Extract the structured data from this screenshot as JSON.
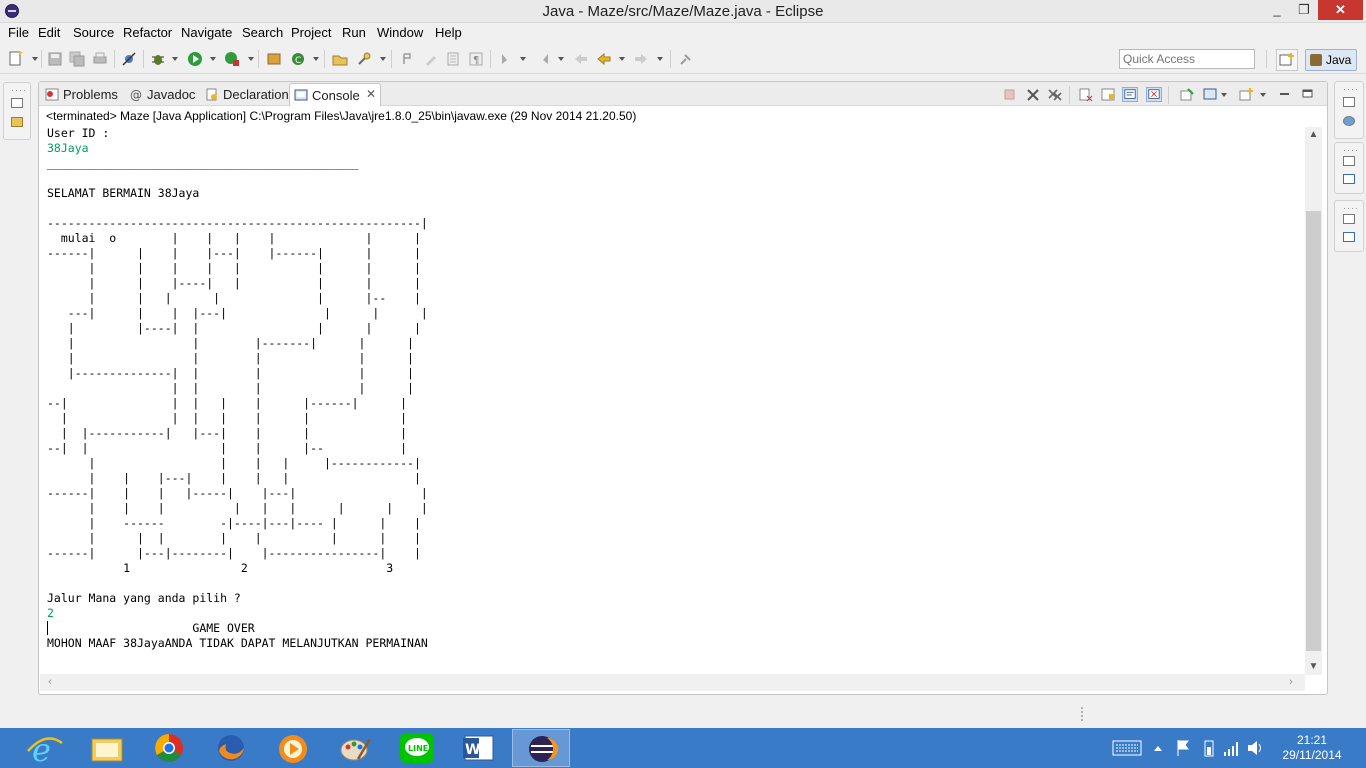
{
  "window": {
    "title": "Java - Maze/src/Maze/Maze.java - Eclipse",
    "min": "_",
    "max": "❐",
    "close": "✕"
  },
  "menu": {
    "items": [
      "File",
      "Edit",
      "Source",
      "Refactor",
      "Navigate",
      "Search",
      "Project",
      "Run",
      "Window",
      "Help"
    ]
  },
  "toolbar": {
    "quick_access_placeholder": "Quick Access",
    "perspective_label": "Java"
  },
  "tabs": [
    {
      "label": "Problems",
      "icon": "problems-icon"
    },
    {
      "label": "Javadoc",
      "icon": "at-icon"
    },
    {
      "label": "Declaration",
      "icon": "declaration-icon"
    },
    {
      "label": "Console",
      "icon": "console-icon",
      "active": true,
      "close": "✕"
    }
  ],
  "console": {
    "terminated": "<terminated> Maze [Java Application] C:\\Program Files\\Java\\jre1.8.0_25\\bin\\javaw.exe (29 Nov 2014 21.20.50)",
    "prompt_user": "User ID :",
    "input_user": "38Jaya",
    "separator": "_____________________________________________",
    "welcome": "SELAMAT BERMAIN 38Jaya",
    "maze": [
      "------------------------------------------------------|",
      "  mulai  o        |    |   |    |             |      |",
      "------|      |    |    |---|    |------|      |      |",
      "      |      |    |    |   |           |      |      |",
      "      |      |    |----|   |           |      |      |",
      "      |      |   |      |              |      |--    |",
      "   ---|      |    |  |---|              |      |      |",
      "   |         |----|  |                 |      |      |",
      "   |                 |        |-------|      |      |",
      "   |                 |        |              |      |",
      "   |--------------|  |        |              |      |",
      "                  |  |        |              |      |",
      "--|               |  |   |    |      |------|      |",
      "  |               |  |   |    |      |             |",
      "  |  |-----------|   |---|    |      |             |",
      "--|  |                   |    |      |--           |",
      "      |                  |    |   |     |------------|",
      "      |    |    |---|    |    |   |                  |",
      "------|    |    |   |-----|    |---|                  |",
      "      |    |    |          |   |   |      |      |    |",
      "      |    ------        -|----|---|---- |      |    |",
      "      |      |  |        |    |          |      |    |",
      "------|      |---|--------|    |----------------|    |",
      "           1                2                    3"
    ],
    "question": "Jalur Mana yang anda pilih ?",
    "input_choice": "2",
    "game_over": "                     GAME OVER",
    "final_message": "MOHON MAAF 38JayaANDA TIDAK DAPAT MELANJUTKAN PERMAINAN"
  },
  "taskbar": {
    "apps": [
      "internet-explorer-icon",
      "file-explorer-icon",
      "chrome-icon",
      "firefox-icon",
      "media-player-icon",
      "paint-icon",
      "line-icon",
      "word-icon",
      "eclipse-icon"
    ],
    "time": "21:21",
    "date": "29/11/2014"
  },
  "colors": {
    "input_text": "#00a060",
    "taskbar": "#3a7bc8"
  }
}
